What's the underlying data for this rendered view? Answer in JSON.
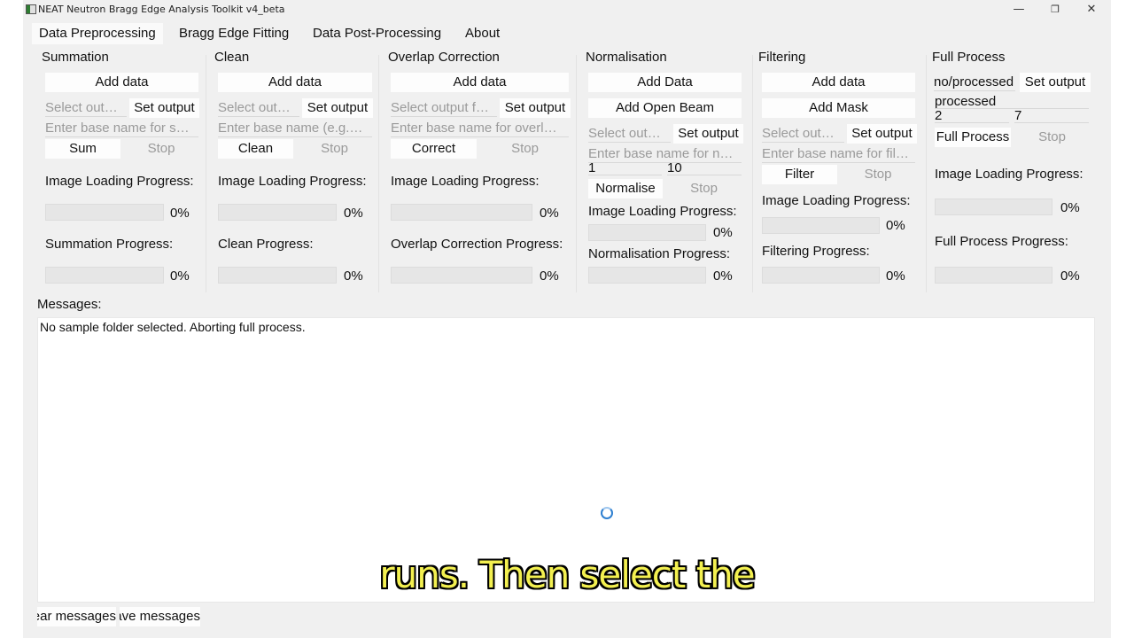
{
  "window": {
    "title": "NEAT Neutron Bragg Edge Analysis Toolkit v4_beta",
    "minimize_glyph": "—",
    "maximize_glyph": "❐",
    "close_glyph": "✕"
  },
  "tabs": [
    {
      "label": "Data Preprocessing",
      "active": true
    },
    {
      "label": "Bragg Edge Fitting"
    },
    {
      "label": "Data Post-Processing"
    },
    {
      "label": "About"
    }
  ],
  "panels": {
    "summation": {
      "title": "Summation",
      "add_data": "Add data",
      "output_placeholder": "Select out…",
      "set_output": "Set output",
      "base_name_placeholder": "Enter base name for s…",
      "run": "Sum",
      "stop": "Stop",
      "loading_label": "Image Loading Progress:",
      "loading_pct": "0%",
      "progress_label": "Summation Progress:",
      "progress_pct": "0%"
    },
    "clean": {
      "title": "Clean",
      "add_data": "Add data",
      "output_placeholder": "Select out…",
      "set_output": "Set output",
      "base_name_placeholder": "Enter base name (e.g.…",
      "run": "Clean",
      "stop": "Stop",
      "loading_label": "Image Loading Progress:",
      "loading_pct": "0%",
      "progress_label": "Clean Progress:",
      "progress_pct": "0%"
    },
    "overlap": {
      "title": "Overlap Correction",
      "add_data": "Add data",
      "output_placeholder": "Select output f…",
      "set_output": "Set output",
      "base_name_placeholder": "Enter base name for overl…",
      "run": "Correct",
      "stop": "Stop",
      "loading_label": "Image Loading Progress:",
      "loading_pct": "0%",
      "progress_label": "Overlap Correction Progress:",
      "progress_pct": "0%"
    },
    "normalisation": {
      "title": "Normalisation",
      "add_data": "Add Data",
      "add_open_beam": "Add Open Beam",
      "output_placeholder": "Select out…",
      "set_output": "Set output",
      "base_name_placeholder": "Enter base name for n…",
      "range_start": "1",
      "range_end": "10",
      "run": "Normalise",
      "stop": "Stop",
      "loading_label": "Image Loading Progress:",
      "loading_pct": "0%",
      "progress_label": "Normalisation Progress:",
      "progress_pct": "0%"
    },
    "filtering": {
      "title": "Filtering",
      "add_data": "Add data",
      "add_mask": "Add Mask",
      "output_placeholder": "Select out…",
      "set_output": "Set output",
      "base_name_placeholder": "Enter base name for fil…",
      "run": "Filter",
      "stop": "Stop",
      "loading_label": "Image Loading Progress:",
      "loading_pct": "0%",
      "progress_label": "Filtering Progress:",
      "progress_pct": "0%"
    },
    "full": {
      "title": "Full Process",
      "output_value": "no/processed",
      "set_output": "Set output",
      "base_name_value": "processed",
      "range_start": "2",
      "range_end": "7",
      "run": "Full Process",
      "stop": "Stop",
      "loading_label": "Image Loading Progress:",
      "loading_pct": "0%",
      "progress_label": "Full Process Progress:",
      "progress_pct": "0%"
    }
  },
  "messages": {
    "label": "Messages:",
    "text": "No sample folder selected. Aborting full process."
  },
  "bottom": {
    "clear": "Clear messages",
    "save": "Save messages"
  },
  "subtitle": "runs. Then select the",
  "colors": {
    "subtitle": "#f3f050",
    "spinner": "#2d7fd0"
  }
}
